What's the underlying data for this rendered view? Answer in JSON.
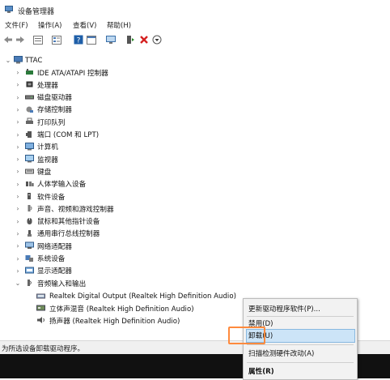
{
  "window": {
    "title": "设备管理器"
  },
  "menu": [
    "文件(F)",
    "操作(A)",
    "查看(V)",
    "帮助(H)"
  ],
  "tree": {
    "root": "TTAC",
    "categories": [
      {
        "label": "IDE ATA/ATAPI 控制器",
        "icon": "ide-controller-icon"
      },
      {
        "label": "处理器",
        "icon": "processor-icon"
      },
      {
        "label": "磁盘驱动器",
        "icon": "disk-drive-icon"
      },
      {
        "label": "存储控制器",
        "icon": "storage-controller-icon"
      },
      {
        "label": "打印队列",
        "icon": "print-queue-icon"
      },
      {
        "label": "端口 (COM 和 LPT)",
        "icon": "port-icon"
      },
      {
        "label": "计算机",
        "icon": "computer-icon"
      },
      {
        "label": "监视器",
        "icon": "monitor-icon"
      },
      {
        "label": "键盘",
        "icon": "keyboard-icon"
      },
      {
        "label": "人体学输入设备",
        "icon": "hid-icon"
      },
      {
        "label": "软件设备",
        "icon": "software-device-icon"
      },
      {
        "label": "声音、视频和游戏控制器",
        "icon": "sound-icon"
      },
      {
        "label": "鼠标和其他指针设备",
        "icon": "mouse-icon"
      },
      {
        "label": "通用串行总线控制器",
        "icon": "usb-icon"
      },
      {
        "label": "网络适配器",
        "icon": "network-adapter-icon"
      },
      {
        "label": "系统设备",
        "icon": "system-device-icon"
      },
      {
        "label": "显示适配器",
        "icon": "display-adapter-icon"
      }
    ],
    "expanded": {
      "label": "音频输入和输出",
      "children": [
        "Realtek Digital Output (Realtek High Definition Audio)",
        "立体声混音 (Realtek High Definition Audio)",
        "扬声器 (Realtek High Definition Audio)"
      ]
    }
  },
  "context_menu": {
    "items": [
      "更新驱动程序软件(P)...",
      "禁用(D)",
      "卸载(U)",
      "扫描检测硬件改动(A)",
      "属性(R)"
    ],
    "selected": "卸载(U)"
  },
  "status": "为所选设备卸载驱动程序。"
}
